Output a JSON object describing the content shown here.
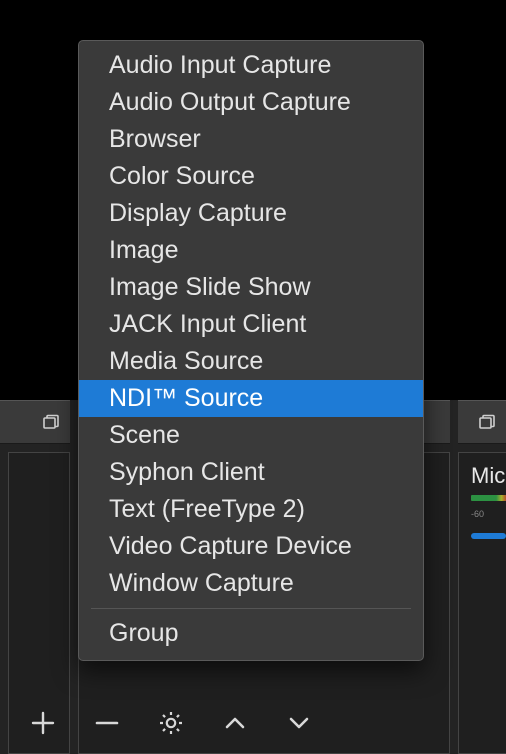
{
  "menu": {
    "items": [
      "Audio Input Capture",
      "Audio Output Capture",
      "Browser",
      "Color Source",
      "Display Capture",
      "Image",
      "Image Slide Show",
      "JACK Input Client",
      "Media Source",
      "NDI™ Source",
      "Scene",
      "Syphon Client",
      "Text (FreeType 2)",
      "Video Capture Device",
      "Window Capture"
    ],
    "selected_index": 9,
    "group_label": "Group"
  },
  "mixer": {
    "channel_label": "Mic",
    "tick_label": "-60"
  },
  "colors": {
    "accent": "#1e7bd6",
    "menu_bg": "#3a3a3a",
    "panel_bg": "#1f1f1f"
  }
}
